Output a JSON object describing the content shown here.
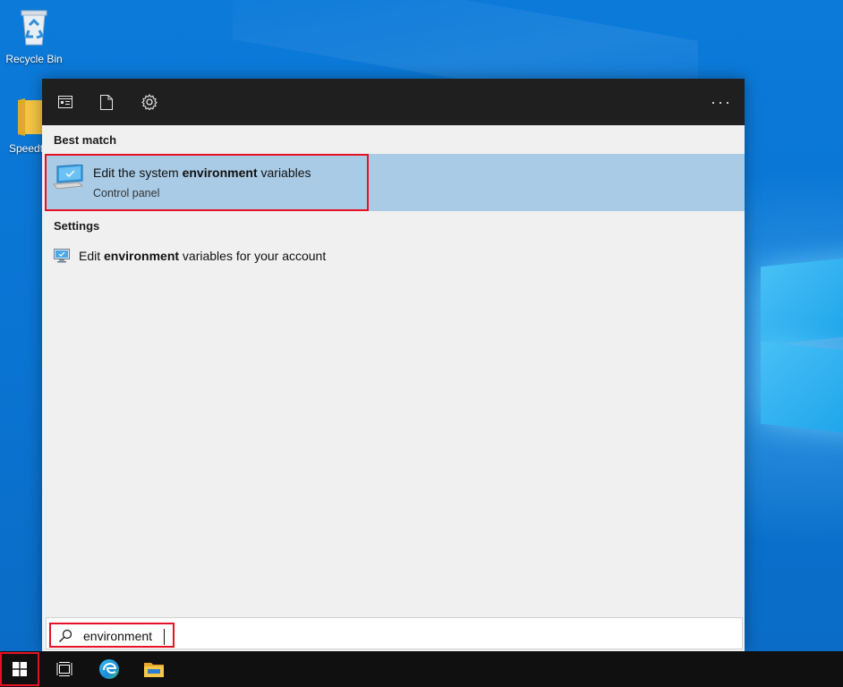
{
  "desktop": {
    "icons": [
      {
        "label": "Recycle Bin",
        "icon": "recycle-bin-icon"
      },
      {
        "label": "Speedt",
        "icon": "folder-icon"
      }
    ]
  },
  "start_menu": {
    "header": {
      "buttons": [
        {
          "name": "apps-button",
          "icon": "apps-icon"
        },
        {
          "name": "documents-button",
          "icon": "document-icon"
        },
        {
          "name": "settings-button",
          "icon": "gear-icon"
        },
        {
          "name": "more-options-button",
          "icon": "ellipsis-icon",
          "label": "···"
        }
      ]
    },
    "best_match": {
      "section_title": "Best match",
      "item": {
        "title_prefix": "Edit the system ",
        "title_bold": "environment",
        "title_suffix": " variables",
        "subtitle": "Control panel",
        "icon": "system-monitor-icon"
      }
    },
    "settings": {
      "section_title": "Settings",
      "item": {
        "title_prefix": "Edit ",
        "title_bold": "environment",
        "title_suffix": " variables for your account",
        "icon": "monitor-settings-icon"
      }
    }
  },
  "search": {
    "value": "environment",
    "icon": "search-icon"
  },
  "taskbar": {
    "items": [
      {
        "name": "start-button",
        "icon": "windows-logo-icon"
      },
      {
        "name": "task-view-button",
        "icon": "task-view-icon"
      },
      {
        "name": "edge-button",
        "icon": "edge-icon"
      },
      {
        "name": "file-explorer-button",
        "icon": "folder-icon"
      }
    ]
  },
  "colors": {
    "highlight": "#a9cbe6",
    "annotation_red": "#e81123",
    "header_bg": "#1f1f1f",
    "taskbar_bg": "#101010"
  }
}
